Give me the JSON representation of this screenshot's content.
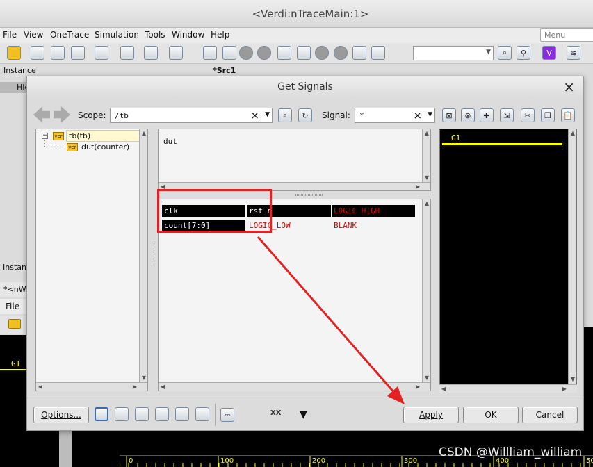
{
  "window": {
    "title": "<Verdi:nTraceMain:1>"
  },
  "menubar": {
    "items": [
      "File",
      "View",
      "OneTrace",
      "Simulation",
      "Tools",
      "Window",
      "Help"
    ],
    "search_placeholder": "Menu"
  },
  "bg": {
    "instance_label": "Instance",
    "src_tab": "*Src1",
    "hier_label": "Hie",
    "instance_label2": "Instan",
    "nwave_tab": "*<nW",
    "file_label": "File",
    "g1_label": "G1",
    "ruler_ticks": [
      "0",
      "100",
      "200",
      "300",
      "400",
      "50"
    ]
  },
  "dialog": {
    "title": "Get Signals",
    "close": "×",
    "scope_label": "Scope:",
    "scope_value": "/tb",
    "signal_label": "Signal:",
    "signal_value": "*",
    "tree": [
      {
        "name": "tb(tb)",
        "badge": "ver"
      },
      {
        "name": "dut(counter)",
        "badge": "ver"
      }
    ],
    "instances": [
      "dut"
    ],
    "signals": [
      [
        "clk",
        "rst_n",
        "",
        "LOGIC_HIGH"
      ],
      [
        "count[7:0]",
        "LOGIC_LOW",
        "BLANK",
        ""
      ]
    ],
    "group_label": "G1",
    "buttons": {
      "options": "Options...",
      "apply": "Apply",
      "ok": "OK",
      "cancel": "Cancel"
    },
    "tool_icons": [
      "ALL",
      "IN",
      "OUT",
      "IO",
      "INT",
      "PRM"
    ]
  },
  "watermark": "CSDN @Willliam_william",
  "colors": {
    "annotation": "#e52020",
    "wave_bg": "#000000",
    "group_line": "#ffff00"
  }
}
